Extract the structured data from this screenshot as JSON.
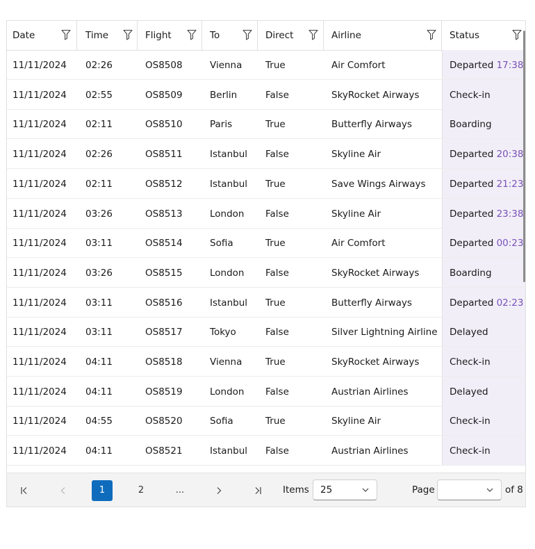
{
  "columns": [
    {
      "key": "date",
      "label": "Date"
    },
    {
      "key": "time",
      "label": "Time"
    },
    {
      "key": "flight",
      "label": "Flight"
    },
    {
      "key": "to",
      "label": "To"
    },
    {
      "key": "direct",
      "label": "Direct"
    },
    {
      "key": "airline",
      "label": "Airline"
    },
    {
      "key": "status",
      "label": "Status"
    }
  ],
  "rows": [
    {
      "date": "11/11/2024",
      "time": "02:26",
      "flight": "OS8508",
      "to": "Vienna",
      "direct": "True",
      "airline": "Air Comfort",
      "status": "Departed",
      "status_time": "17:38"
    },
    {
      "date": "11/11/2024",
      "time": "02:55",
      "flight": "OS8509",
      "to": "Berlin",
      "direct": "False",
      "airline": "SkyRocket Airways",
      "status": "Check-in",
      "status_time": ""
    },
    {
      "date": "11/11/2024",
      "time": "02:11",
      "flight": "OS8510",
      "to": "Paris",
      "direct": "True",
      "airline": "Butterfly Airways",
      "status": "Boarding",
      "status_time": ""
    },
    {
      "date": "11/11/2024",
      "time": "02:26",
      "flight": "OS8511",
      "to": "Istanbul",
      "direct": "False",
      "airline": "Skyline Air",
      "status": "Departed",
      "status_time": "20:38"
    },
    {
      "date": "11/11/2024",
      "time": "02:11",
      "flight": "OS8512",
      "to": "Istanbul",
      "direct": "True",
      "airline": "Save Wings Airways",
      "status": "Departed",
      "status_time": "21:23"
    },
    {
      "date": "11/11/2024",
      "time": "03:26",
      "flight": "OS8513",
      "to": "London",
      "direct": "False",
      "airline": "Skyline Air",
      "status": "Departed",
      "status_time": "23:38"
    },
    {
      "date": "11/11/2024",
      "time": "03:11",
      "flight": "OS8514",
      "to": "Sofia",
      "direct": "True",
      "airline": "Air Comfort",
      "status": "Departed",
      "status_time": "00:23"
    },
    {
      "date": "11/11/2024",
      "time": "03:26",
      "flight": "OS8515",
      "to": "London",
      "direct": "False",
      "airline": "SkyRocket Airways",
      "status": "Boarding",
      "status_time": ""
    },
    {
      "date": "11/11/2024",
      "time": "03:11",
      "flight": "OS8516",
      "to": "Istanbul",
      "direct": "True",
      "airline": "Butterfly Airways",
      "status": "Departed",
      "status_time": "02:23"
    },
    {
      "date": "11/11/2024",
      "time": "03:11",
      "flight": "OS8517",
      "to": "Tokyo",
      "direct": "False",
      "airline": "Silver Lightning Airline",
      "status": "Delayed",
      "status_time": ""
    },
    {
      "date": "11/11/2024",
      "time": "04:11",
      "flight": "OS8518",
      "to": "Vienna",
      "direct": "True",
      "airline": "SkyRocket Airways",
      "status": "Check-in",
      "status_time": ""
    },
    {
      "date": "11/11/2024",
      "time": "04:11",
      "flight": "OS8519",
      "to": "London",
      "direct": "False",
      "airline": "Austrian Airlines",
      "status": "Delayed",
      "status_time": ""
    },
    {
      "date": "11/11/2024",
      "time": "04:55",
      "flight": "OS8520",
      "to": "Sofia",
      "direct": "True",
      "airline": "Skyline Air",
      "status": "Check-in",
      "status_time": ""
    },
    {
      "date": "11/11/2024",
      "time": "04:11",
      "flight": "OS8521",
      "to": "Istanbul",
      "direct": "False",
      "airline": "Austrian Airlines",
      "status": "Check-in",
      "status_time": ""
    }
  ],
  "pager": {
    "pages": [
      "1",
      "2",
      "..."
    ],
    "current_page": "1",
    "items_label": "Items",
    "page_size": "25",
    "page_label": "Page",
    "page_value": "",
    "total_label": "of 8"
  },
  "colors": {
    "accent": "#0f6cbd",
    "status_bg": "#f1eef8",
    "status_time": "#7a52b8"
  },
  "icons": {
    "filter": "filter-icon",
    "first": "first-page-icon",
    "prev": "chevron-left-icon",
    "next": "chevron-right-icon",
    "last": "last-page-icon",
    "dropdown": "chevron-down-icon"
  }
}
